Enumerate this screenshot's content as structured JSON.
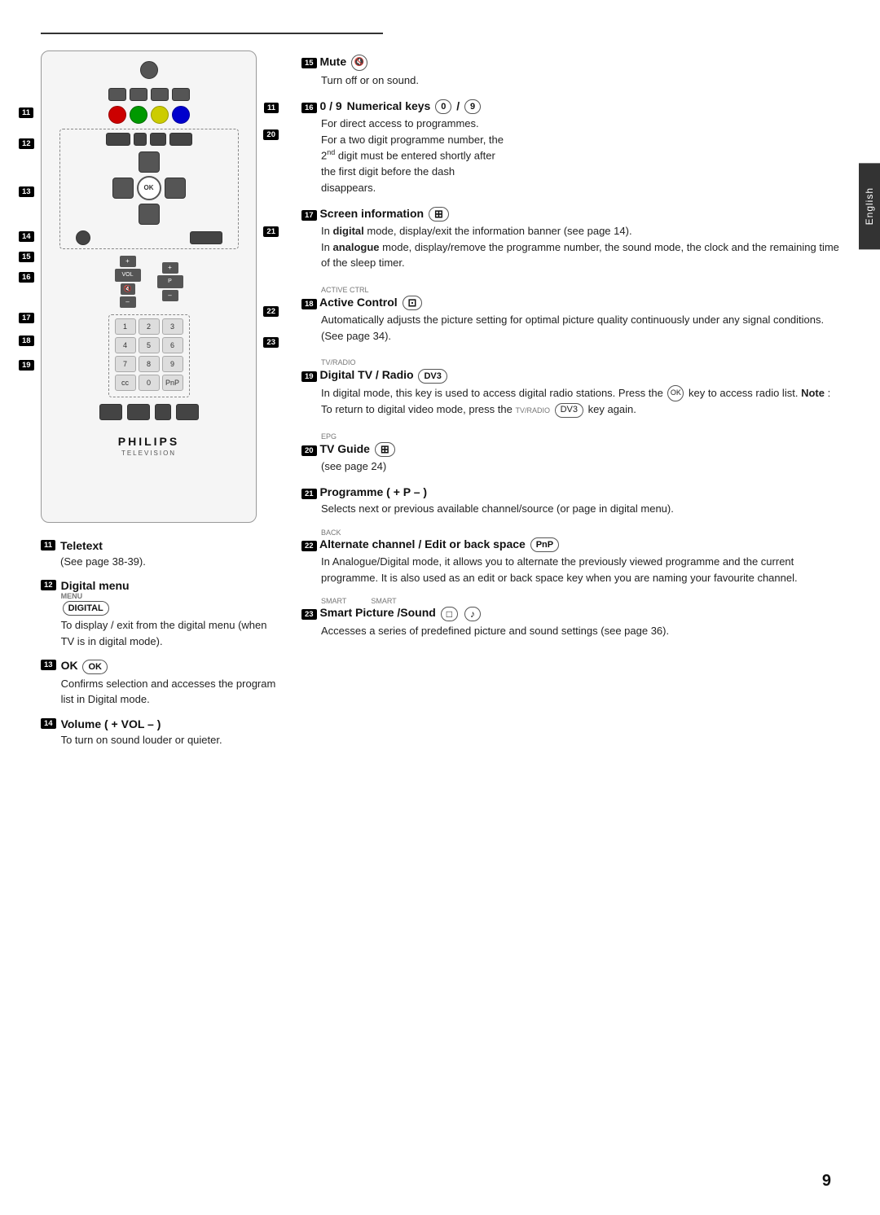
{
  "page": {
    "number": "9",
    "english_tab": "English"
  },
  "sections": {
    "item11": {
      "num": "11",
      "title": "Teletext",
      "body": "(See page 38-39)."
    },
    "item12": {
      "num": "12",
      "title": "Digital menu",
      "label_above": "MENU",
      "btn_label": "DIGITAL",
      "body": "To display / exit from the digital menu (when TV is in digital mode)."
    },
    "item13": {
      "num": "13",
      "title": "OK",
      "btn_label": "OK",
      "body": "Confirms selection and accesses the program list in Digital mode."
    },
    "item14": {
      "num": "14",
      "title": "Volume ( + VOL – )",
      "body": "To turn on sound louder or quieter."
    },
    "item15": {
      "num": "15",
      "title": "Mute",
      "icon": "🔇",
      "body": "Turn off or on sound."
    },
    "item16": {
      "num": "16",
      "title_prefix": "0 / 9",
      "title": "Numerical keys",
      "btn0": "0",
      "btn9": "9",
      "body": "For direct access to programmes.\nFor a two digit programme number, the 2nd digit must be entered shortly after the first digit before the dash disappears."
    },
    "item17": {
      "num": "17",
      "title": "Screen information",
      "icon": "⊞",
      "body_digital": "In digital mode, display/exit the information banner (see page 14).",
      "body_analogue": "In analogue mode, display/remove the programme number, the sound mode, the clock and the remaining time of the sleep timer."
    },
    "item18": {
      "num": "18",
      "title": "Active Control",
      "label_above": "ACTIVE CTRL",
      "icon": "⊡",
      "body": "Automatically adjusts the picture setting for optimal picture quality continuously under any signal conditions. (See page 34)."
    },
    "item19": {
      "num": "19",
      "title": "Digital TV / Radio",
      "label_above": "TV/RADIO",
      "btn_label": "DV3",
      "body": "In digital mode, this key is used to access digital radio stations. Press the OK key to access radio list. Note : To return to digital video mode, press the TV/RADIO key again.",
      "btn_ok": "OK",
      "btn_dv3": "DV3"
    },
    "item20": {
      "num": "20",
      "title": "TV Guide",
      "label_above": "EPG",
      "icon": "⊞",
      "body": "(see page 24)"
    },
    "item21": {
      "num": "21",
      "title": "Programme  ( + P – )",
      "body": "Selects next or previous available channel/source (or page in digital menu)."
    },
    "item22": {
      "num": "22",
      "title": "Alternate channel / Edit or back space",
      "label_above": "BACK",
      "btn_label": "PnP",
      "body": "In Analogue/Digital mode, it allows you to alternate the previously viewed programme and the current programme. It is also used as an edit or back space key when you are naming your favourite channel."
    },
    "item23": {
      "num": "23",
      "title": "Smart Picture /Sound",
      "label_smart1": "SMART",
      "label_smart2": "SMART",
      "icon1": "□",
      "icon2": "♪",
      "body": "Accesses a series of predefined picture and sound settings (see page 36)."
    }
  }
}
